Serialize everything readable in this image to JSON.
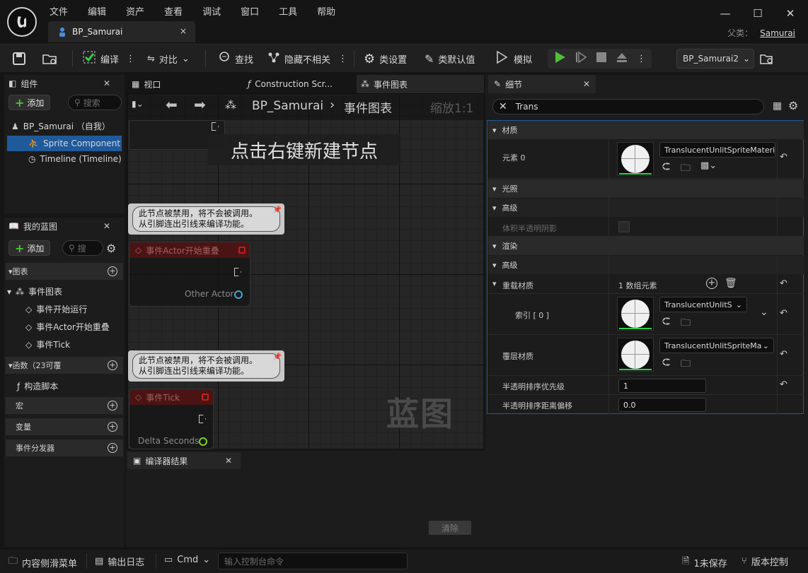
{
  "menu": [
    "文件",
    "编辑",
    "资产",
    "查看",
    "调试",
    "窗口",
    "工具",
    "帮助"
  ],
  "doc_tab": {
    "name": "BP_Samurai",
    "close": "×"
  },
  "window": {
    "min": "—",
    "max": "☐",
    "close": "✕"
  },
  "parent": {
    "label": "父类：",
    "value": "Samurai"
  },
  "toolbar": {
    "compile": "编译",
    "diff": "对比",
    "find": "查找",
    "hide": "隐藏不相关",
    "class_settings": "类设置",
    "class_defaults": "类默认值",
    "simulate": "模拟",
    "debug_object": "BP_Samurai2"
  },
  "components": {
    "tab": "组件",
    "add": "添加",
    "search_placeholder": "搜索",
    "root": "BP_Samurai （自我）",
    "items": [
      "Sprite Component (",
      "Timeline (Timeline)"
    ]
  },
  "mybp": {
    "tab": "我的蓝图",
    "add": "添加",
    "search_placeholder": "搜",
    "graphs_header": "图表",
    "event_graph": "事件图表",
    "events": [
      "事件开始运行",
      "事件Actor开始重叠",
      "事件Tick"
    ],
    "functions_header": "函数（23可覆",
    "construct": "构造脚本",
    "macros": "宏",
    "variables": "变量",
    "dispatchers": "事件分发器"
  },
  "center_tabs": {
    "viewport": "视口",
    "construction": "Construction Scr...",
    "event_graph": "事件图表"
  },
  "graph": {
    "breadcrumb_bp": "BP_Samurai",
    "breadcrumb_sep": "›",
    "breadcrumb_graph": "事件图表",
    "zoom": "缩放1:1",
    "hint": "点击右键新建节点",
    "watermark": "蓝图",
    "comment_text_1": "此节点被禁用，将不会被调用。",
    "comment_text_2": "从引脚连出引线来编译功能。",
    "node_overlap": "事件Actor开始重叠",
    "pin_other_actor": "Other Actor",
    "node_tick": "事件Tick",
    "pin_delta": "Delta Seconds"
  },
  "compiler": {
    "tab": "编译器结果",
    "clear": "清除"
  },
  "details": {
    "tab": "细节",
    "search_value": "Trans",
    "sec_material": "材质",
    "element0": "元素 0",
    "mat_name": "TranslucentUnlitSpriteMaterial",
    "sec_lighting": "光照",
    "advanced": "高级",
    "vol_shadow": "体积半透明阴影",
    "sec_rendering": "渲染",
    "advanced2": "高级",
    "override_mat": "重载材质",
    "array_count": "1 数组元素",
    "index0": "索引 [ 0 ]",
    "index_mat": "TranslucentUnlitS",
    "overlay_mat": "覆层材质",
    "overlay_name": "TranslucentUnlitSpriteMa",
    "sort_priority": "半透明排序优先级",
    "sort_priority_val": "1",
    "sort_offset": "半透明排序距离偏移",
    "sort_offset_val": "0.0"
  },
  "status": {
    "drawer": "内容侧滑菜单",
    "output": "输出日志",
    "cmd": "Cmd",
    "cmd_placeholder": "输入控制台命令",
    "unsaved": "1未保存",
    "source": "版本控制"
  },
  "colors": {
    "accent": "#2fd14a",
    "play": "#4fbf3a",
    "select": "#1f5a9a"
  }
}
